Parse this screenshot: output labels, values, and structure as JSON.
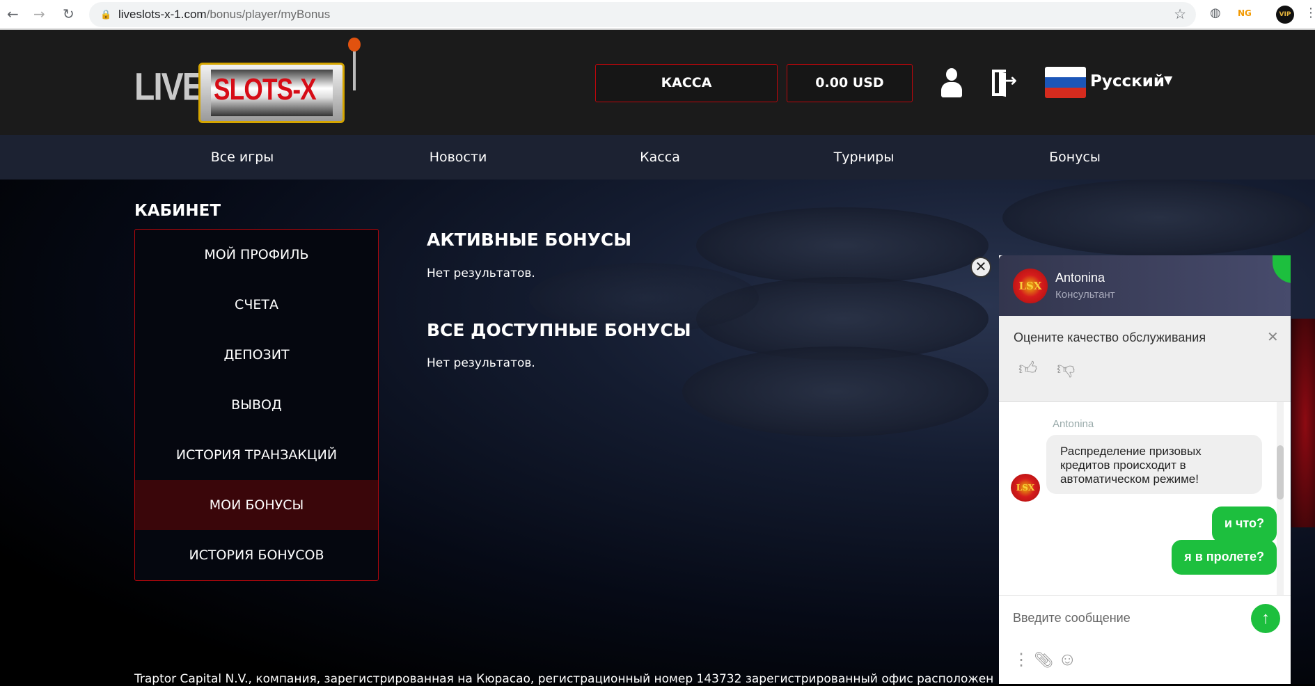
{
  "browser": {
    "url_host": "liveslots-x-1.com",
    "url_path": "/bonus/player/myBonus",
    "ext_badge": "NG",
    "ext_vip": "VIP"
  },
  "header": {
    "logo_live": "LIVE",
    "logo_slots": "SLOTS-X",
    "kassa": "КАССА",
    "balance": "0.00 USD",
    "language": "Русский"
  },
  "nav": [
    "Все игры",
    "Новости",
    "Касса",
    "Турниры",
    "Бонусы"
  ],
  "cabinet": {
    "title": "КАБИНЕТ",
    "items": [
      "Мой профиль",
      "Счета",
      "Депозит",
      "Вывод",
      "История транзакций",
      "Мои бонусы",
      "История бонусов"
    ],
    "active_index": 5
  },
  "content": {
    "active_title": "АКТИВНЫЕ БОНУСЫ",
    "active_empty": "Нет результатов.",
    "all_title": "ВСЕ ДОСТУПНЫЕ БОНУСЫ",
    "all_empty": "Нет результатов."
  },
  "footer": {
    "text": "Traptor Capital N.V., компания, зарегистрированная на Кюрасао, регистрационный номер 143732 зарегистрированный офис расположен"
  },
  "chat": {
    "agent_name": "Antonina",
    "agent_role": "Консультант",
    "rate_prompt": "Оцените качество обслуживания",
    "sender": "Antonina",
    "agent_message": "Распределение призовых кредитов происходит в автоматическом режиме!",
    "user_messages": [
      "и что?",
      "я в пролете?"
    ],
    "input_placeholder": "Введите сообщение",
    "accent": "#1dbf3e",
    "logo_text": "LSX"
  }
}
